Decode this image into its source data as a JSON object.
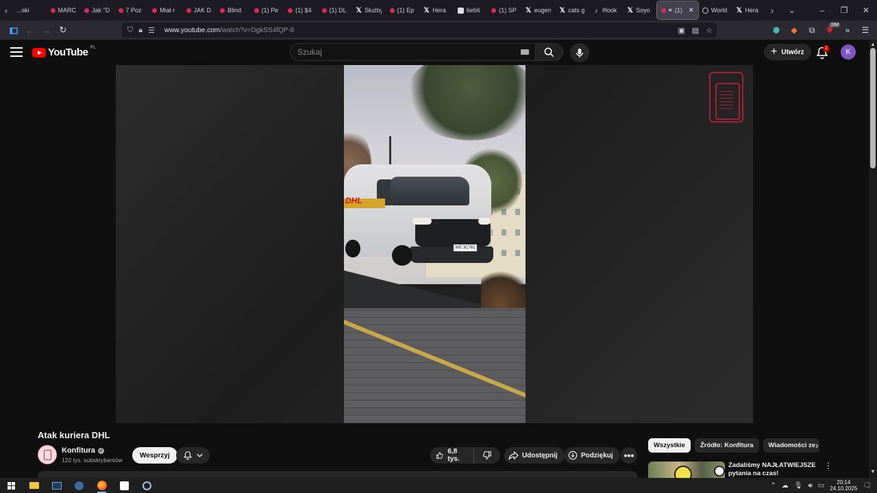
{
  "browser": {
    "tabs": [
      {
        "label": "...ski",
        "icon": "none"
      },
      {
        "label": "MARC",
        "icon": "yt"
      },
      {
        "label": "Jak \"D",
        "icon": "yt"
      },
      {
        "label": "7 Poz",
        "icon": "yt"
      },
      {
        "label": "Miał r",
        "icon": "yt"
      },
      {
        "label": "JAK D",
        "icon": "yt"
      },
      {
        "label": "Blind",
        "icon": "yt"
      },
      {
        "label": "(1) Pe",
        "icon": "yt"
      },
      {
        "label": "(1) $4",
        "icon": "yt"
      },
      {
        "label": "(1) DL",
        "icon": "yt"
      },
      {
        "label": "Służby",
        "icon": "x"
      },
      {
        "label": "(1) Ep",
        "icon": "yt"
      },
      {
        "label": "Hera",
        "icon": "x"
      },
      {
        "label": "6eb6",
        "icon": "doc"
      },
      {
        "label": "(1) SP",
        "icon": "yt"
      },
      {
        "label": "eugen",
        "icon": "x"
      },
      {
        "label": "cats g",
        "icon": "x"
      },
      {
        "label": "#look",
        "icon": "tt"
      },
      {
        "label": "Soyo",
        "icon": "x"
      },
      {
        "label": "(1)",
        "icon": "yt",
        "active": true
      },
      {
        "label": "World",
        "icon": "globe"
      },
      {
        "label": "Hera",
        "icon": "x"
      }
    ],
    "url_host": "www.youtube.com",
    "url_path": "/watch?v=DgkSS4fQP-8",
    "extensions_badge": "184"
  },
  "youtube": {
    "logo_text": "YouTube",
    "country_code": "PL",
    "search_placeholder": "Szukaj",
    "create_label": "Utwórz",
    "notification_count": "1",
    "avatar_letter": "K"
  },
  "video": {
    "title": "Atak kuriera DHL",
    "van_plate": "WE 3C761",
    "van_brand": "DHL"
  },
  "channel": {
    "name": "Konfitura",
    "subscribers": "122 tys. subskrybentów",
    "support_label": "Wesprzyj"
  },
  "actions": {
    "likes": "6,8 tys.",
    "share_label": "Udostępnij",
    "thanks_label": "Podziękuj"
  },
  "chips": [
    "Wszystkie",
    "Źródło: Konfitura",
    "Wiadomości ze"
  ],
  "recommendation": {
    "title": "Zadaliśmy NAJŁATWIEJSZE pytania na czas!"
  },
  "taskbar": {
    "time": "20:14",
    "date": "24.10.2025"
  },
  "colors": {
    "yt_red": "#ff0000",
    "bg": "#0f0f0f",
    "watermark": "#b0203a",
    "avatar": "#7e57c2"
  }
}
